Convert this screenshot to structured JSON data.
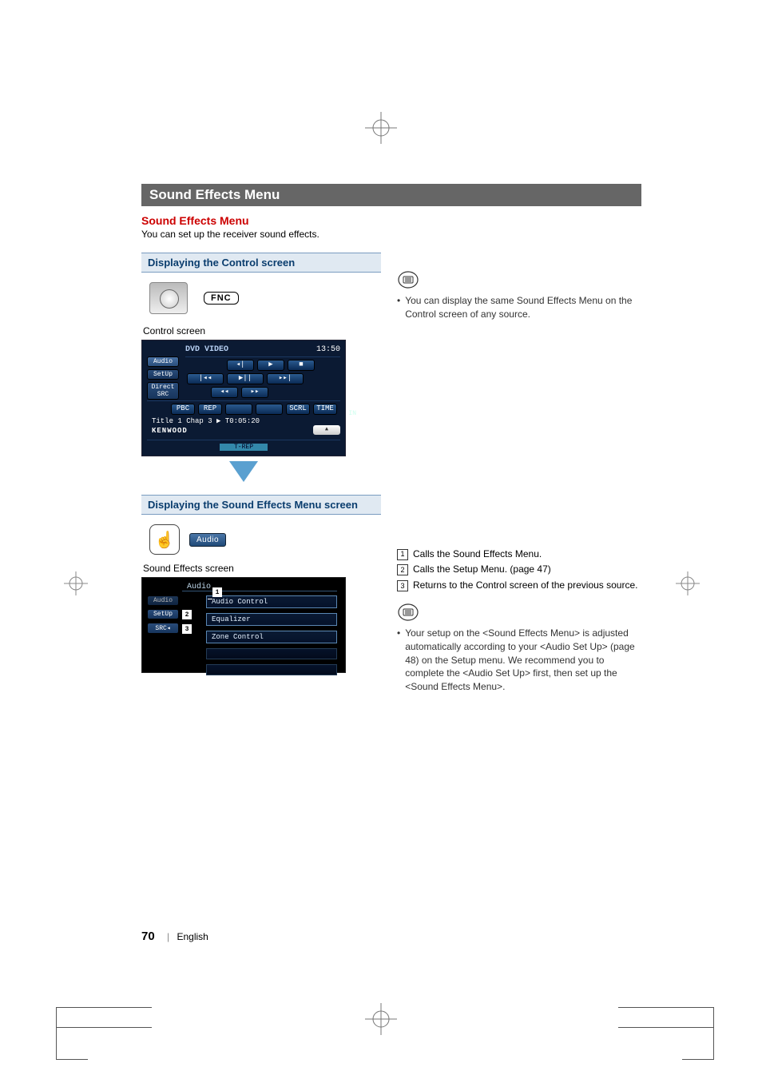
{
  "section_bar": "Sound Effects Menu",
  "sub_heading": "Sound Effects Menu",
  "sub_desc": "You can set up the receiver sound effects.",
  "left": {
    "panel1_title": "Displaying the Control screen",
    "fnc_label": "FNC",
    "control_caption": "Control screen",
    "ctrl": {
      "source": "DVD VIDEO",
      "time": "13:50",
      "tabs": {
        "audio": "Audio",
        "setup": "SetUp",
        "direct": "Direct SRC"
      },
      "pbc": "PBC",
      "rep": "REP",
      "scrl": "SCRL",
      "time_btn": "TIME",
      "title_line": "Title 1   Chap   3  ▶  T0:05:20",
      "brand": "KENWOOD",
      "in_label": "IN",
      "trep": "T-REP"
    },
    "panel2_title": "Displaying the Sound Effects Menu screen",
    "audio_btn": "Audio",
    "sfx_caption": "Sound Effects screen",
    "sfx": {
      "heading": "Audio",
      "tabs": {
        "audio": "Audio",
        "setup": "SetUp",
        "src": "SRC◂"
      },
      "items": [
        "Audio Control",
        "Equalizer",
        "Zone Control"
      ]
    }
  },
  "right": {
    "note1": "You can display the same Sound Effects Menu on the Control screen of any source.",
    "callouts": [
      "Calls the Sound Effects Menu.",
      "Calls the Setup Menu. (page 47)",
      "Returns to the Control screen of the previous source."
    ],
    "note2": "Your setup on the <Sound Effects Menu> is adjusted automatically according to your <Audio Set Up> (page 48) on the Setup menu. We recommend you to complete the <Audio Set Up> first, then set up the <Sound Effects Menu>."
  },
  "callout_nums": [
    "1",
    "2",
    "3"
  ],
  "footer": {
    "page": "70",
    "lang": "English"
  }
}
